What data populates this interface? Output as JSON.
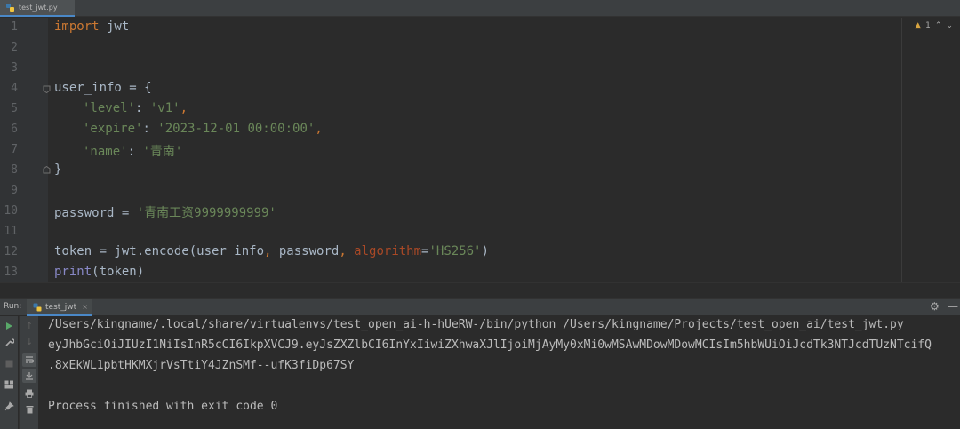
{
  "editor_tab": {
    "label": "test_jwt.py",
    "close": "×"
  },
  "inspection": {
    "warning_count": "1",
    "up": "⌃",
    "down": "⌄"
  },
  "line_numbers": [
    "1",
    "2",
    "3",
    "4",
    "5",
    "6",
    "7",
    "8",
    "9",
    "10",
    "11",
    "12",
    "13"
  ],
  "code": {
    "l1_kw": "import",
    "l1_rest": " jwt",
    "l4": "user_info = {",
    "l5_key": "'level'",
    "l5_sep": ": ",
    "l5_val": "'v1'",
    "l5_end": ",",
    "l6_key": "'expire'",
    "l6_sep": ": ",
    "l6_val": "'2023-12-01 00:00:00'",
    "l6_end": ",",
    "l7_key": "'name'",
    "l7_sep": ": ",
    "l7_val": "'青南'",
    "l8": "}",
    "l10_pre": "password = ",
    "l10_val": "'青南工资9999999999'",
    "l12_pre": "token = jwt.encode(user_info",
    "l12_c1": ",",
    "l12_mid": " password",
    "l12_c2": ",",
    "l12_param": " algorithm",
    "l12_eq": "=",
    "l12_val": "'HS256'",
    "l12_end": ")",
    "l13_fn": "print",
    "l13_rest": "(token)"
  },
  "run": {
    "title": "Run:",
    "tab_label": "test_jwt",
    "tab_close": "×",
    "settings": "⚙",
    "minimize": "—"
  },
  "console": {
    "line1": "/Users/kingname/.local/share/virtualenvs/test_open_ai-h-hUeRW-/bin/python /Users/kingname/Projects/test_open_ai/test_jwt.py",
    "line2": "eyJhbGciOiJIUzI1NiIsInR5cCI6IkpXVCJ9.eyJsZXZlbCI6InYxIiwiZXhwaXJlIjoiMjAyMy0xMi0wMSAwMDowMDowMCIsIm5hbWUiOiJcdTk3NTJcdTUzNTcifQ",
    "line3": ".8xEkWL1pbtHKMXjrVsTtiY4JZnSMf--ufK3fiDp67SY",
    "line4": "Process finished with exit code 0"
  },
  "colors": {
    "keyword": "#cc7832",
    "string": "#6a8759",
    "param": "#aa4926",
    "builtin": "#8888c6",
    "text": "#a9b7c6"
  }
}
